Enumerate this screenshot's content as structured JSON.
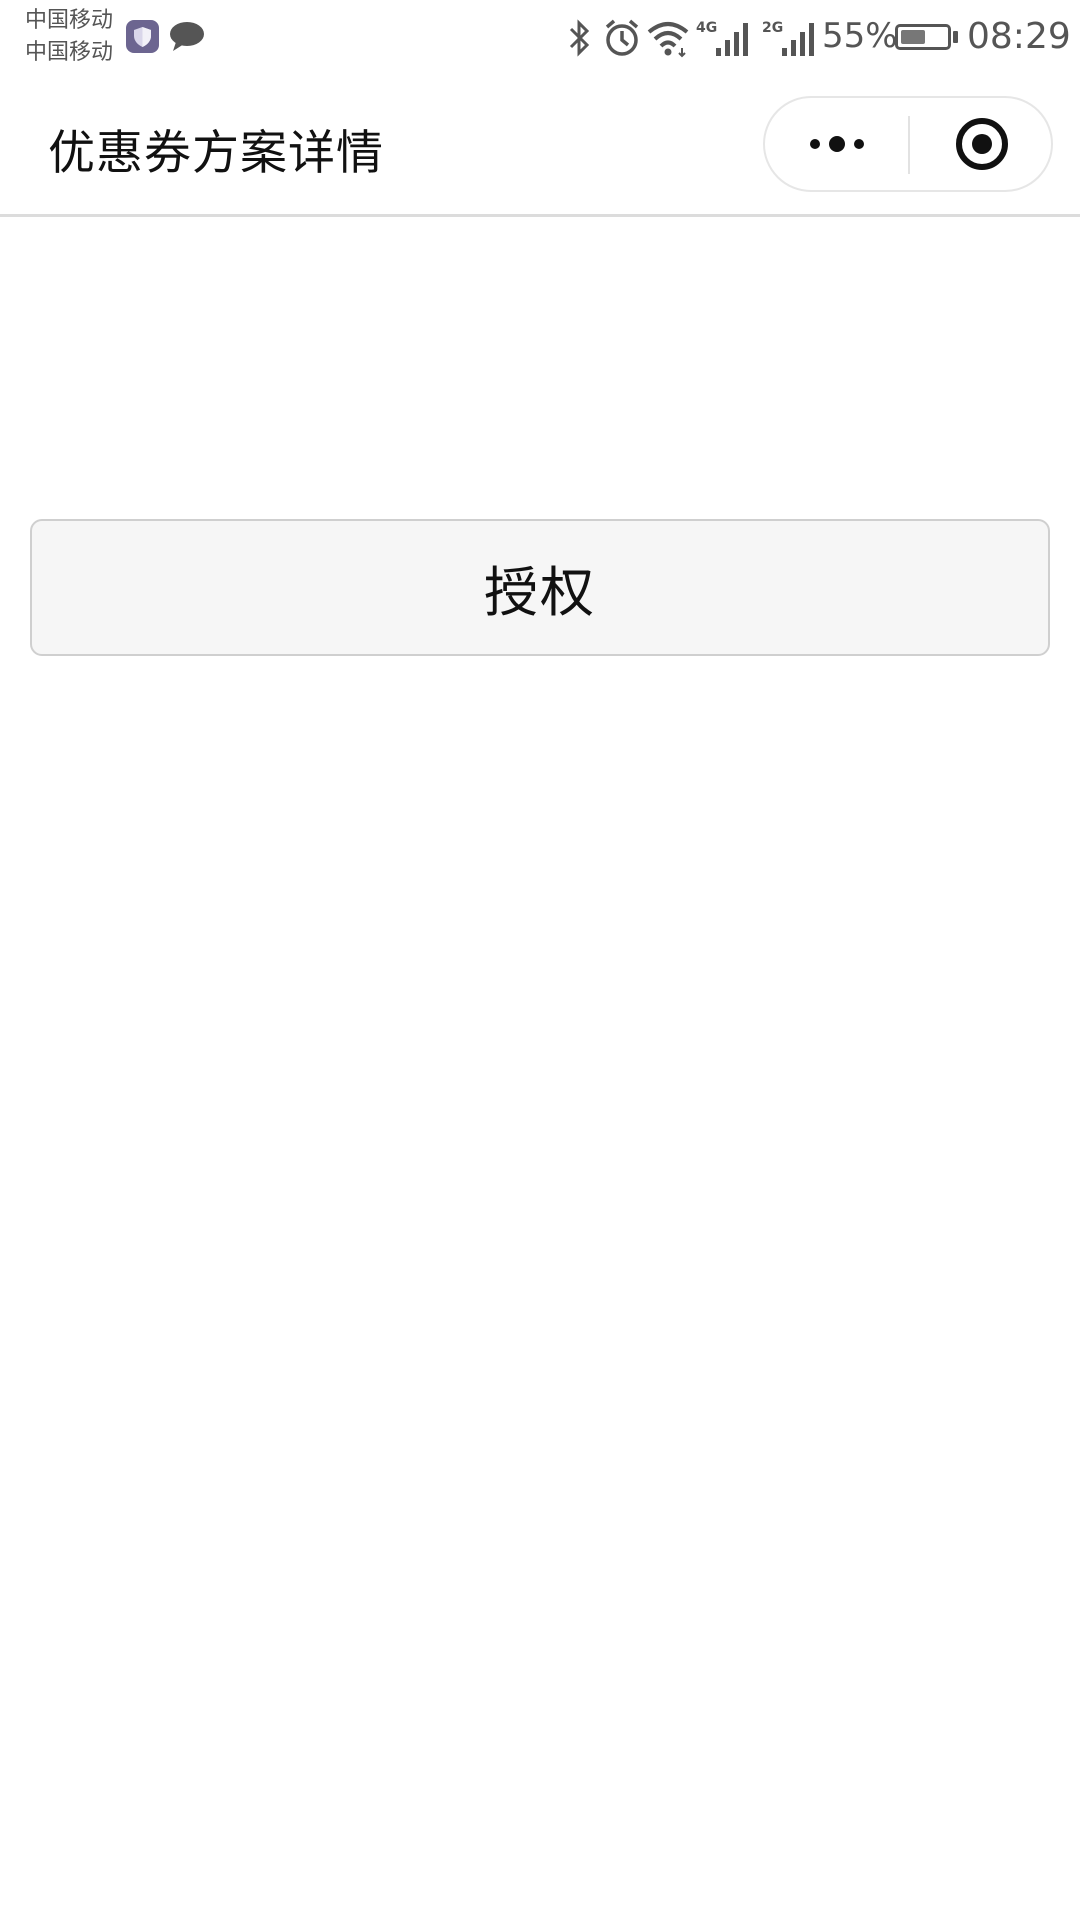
{
  "status_bar": {
    "carrier_1": "中国移动",
    "carrier_2": "中国移动",
    "network_1": "4G",
    "network_2": "2G",
    "battery_percent": "55%",
    "battery_level": 0.55,
    "time": "08:29",
    "icons": [
      "security-shield-icon",
      "chat-bubble-icon",
      "bluetooth-icon",
      "alarm-icon",
      "wifi-icon",
      "signal-4g-icon",
      "signal-2g-icon",
      "battery-icon"
    ]
  },
  "navbar": {
    "title": "优惠券方案详情",
    "capsule_icons": [
      "more-dots-icon",
      "close-target-icon"
    ]
  },
  "main": {
    "authorize_button_label": "授权"
  },
  "colors": {
    "background": "#ffffff",
    "button_bg": "#f6f6f6",
    "button_border": "#cfcfcf",
    "status_text": "#555555",
    "shield_app": "#6c6590"
  }
}
